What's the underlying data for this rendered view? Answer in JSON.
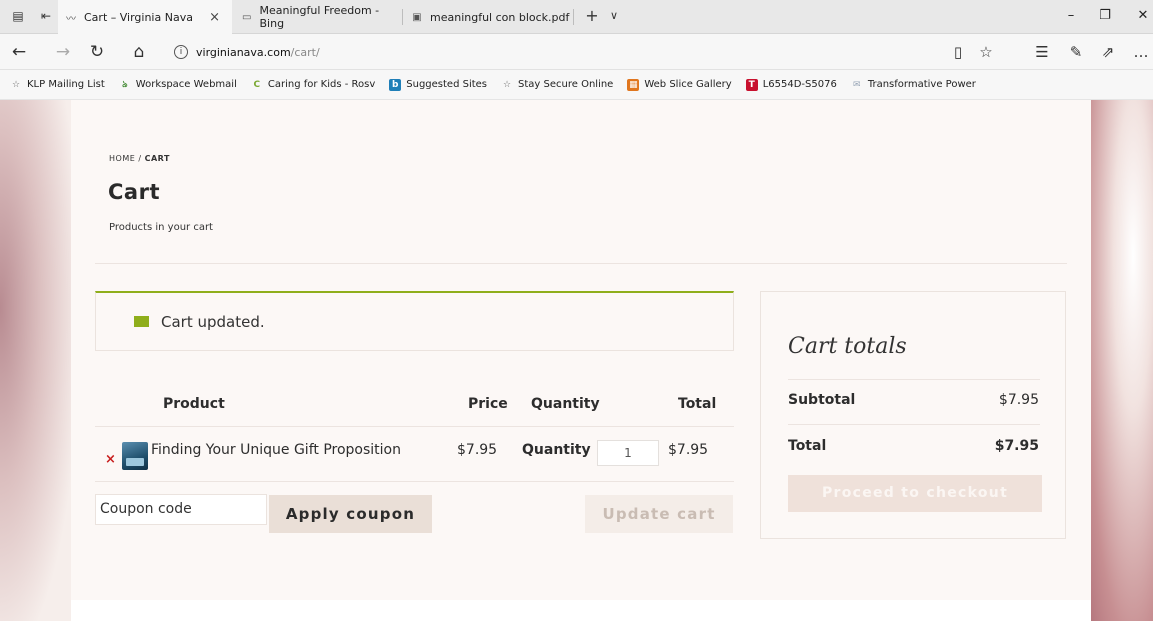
{
  "browser": {
    "tabs": [
      {
        "title": "Cart – Virginia Nava",
        "icon": "site-favicon"
      },
      {
        "title": "Meaningful Freedom - Bing",
        "icon": "page-icon"
      },
      {
        "title": "meaningful con block.pdf",
        "icon": "pdf-icon"
      }
    ],
    "tab_close": "×",
    "new_tab": "+",
    "tab_list": "∨",
    "window_controls": {
      "minimize": "–",
      "restore": "❐",
      "close": "✕"
    },
    "url_host": "virginianava.com",
    "url_path": "/cart/",
    "favorites": [
      {
        "label": "KLP Mailing List",
        "icon": "star-icon",
        "color": "#666666"
      },
      {
        "label": "Workspace Webmail",
        "icon": "webmail-icon",
        "color": "#4a8f3c"
      },
      {
        "label": "Caring for Kids - Rosv",
        "icon": "c-logo-icon",
        "color": "#7aa833"
      },
      {
        "label": "Suggested Sites",
        "icon": "bing-icon",
        "color": "#1f7fb8"
      },
      {
        "label": "Stay Secure Online",
        "icon": "star-icon",
        "color": "#666666"
      },
      {
        "label": "Web Slice Gallery",
        "icon": "web-slice-icon",
        "color": "#e0761e"
      },
      {
        "label": "L6554D-S5076",
        "icon": "t-logo-icon",
        "color": "#c8102e"
      },
      {
        "label": "Transformative Power",
        "icon": "mail-icon",
        "color": "#9aa7b8"
      }
    ]
  },
  "page": {
    "breadcrumb": {
      "home": "HOME",
      "separator": "/",
      "current": "CART"
    },
    "title": "Cart",
    "subtitle": "Products in your cart",
    "notice": "Cart updated.",
    "table": {
      "headers": {
        "product": "Product",
        "price": "Price",
        "quantity": "Quantity",
        "total": "Total"
      },
      "rows": [
        {
          "remove": "×",
          "product": "Finding Your Unique Gift Proposition",
          "price": "$7.95",
          "quantity_label": "Quantity",
          "quantity": "1",
          "total": "$7.95"
        }
      ]
    },
    "coupon_placeholder": "Coupon code",
    "apply_coupon": "Apply coupon",
    "update_cart": "Update cart",
    "totals": {
      "title": "Cart totals",
      "subtotal_label": "Subtotal",
      "subtotal_value": "$7.95",
      "total_label": "Total",
      "total_value": "$7.95",
      "checkout": "Proceed to checkout"
    }
  },
  "colors": {
    "accent": "#8fae1b",
    "remove": "#c81e1e",
    "button_bg": "#eadfd7"
  }
}
